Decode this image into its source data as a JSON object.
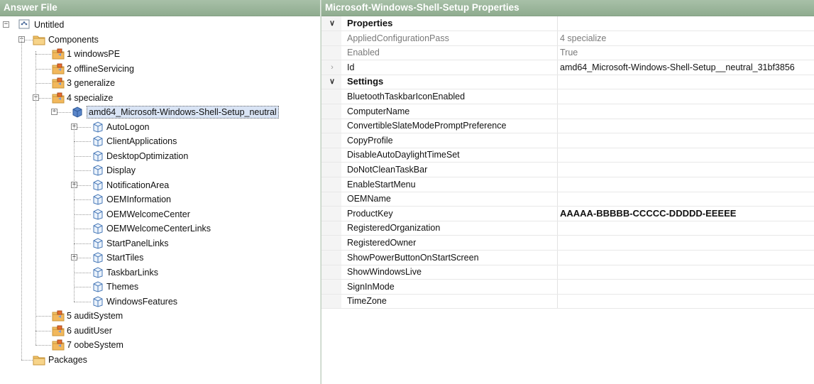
{
  "left_pane": {
    "title": "Answer File",
    "tree": {
      "root": "Untitled",
      "components": "Components",
      "passes": [
        "1 windowsPE",
        "2 offlineServicing",
        "3 generalize",
        "4 specialize"
      ],
      "component": "amd64_Microsoft-Windows-Shell-Setup_neutral",
      "settings": [
        "AutoLogon",
        "ClientApplications",
        "DesktopOptimization",
        "Display",
        "NotificationArea",
        "OEMInformation",
        "OEMWelcomeCenter",
        "OEMWelcomeCenterLinks",
        "StartPanelLinks",
        "StartTiles",
        "TaskbarLinks",
        "Themes",
        "WindowsFeatures"
      ],
      "later_passes": [
        "5 auditSystem",
        "6 auditUser",
        "7 oobeSystem"
      ],
      "packages": "Packages"
    }
  },
  "right_pane": {
    "title": "Microsoft-Windows-Shell-Setup Properties",
    "properties_category": "Properties",
    "properties": [
      {
        "name": "AppliedConfigurationPass",
        "value": "4 specialize"
      },
      {
        "name": "Enabled",
        "value": "True"
      },
      {
        "name": "Id",
        "value": "amd64_Microsoft-Windows-Shell-Setup__neutral_31bf3856"
      }
    ],
    "settings_category": "Settings",
    "settings": [
      {
        "name": "BluetoothTaskbarIconEnabled",
        "value": ""
      },
      {
        "name": "ComputerName",
        "value": ""
      },
      {
        "name": "ConvertibleSlateModePromptPreference",
        "value": ""
      },
      {
        "name": "CopyProfile",
        "value": ""
      },
      {
        "name": "DisableAutoDaylightTimeSet",
        "value": ""
      },
      {
        "name": "DoNotCleanTaskBar",
        "value": ""
      },
      {
        "name": "EnableStartMenu",
        "value": ""
      },
      {
        "name": "OEMName",
        "value": ""
      },
      {
        "name": "ProductKey",
        "value": "AAAAA-BBBBB-CCCCC-DDDDD-EEEEE"
      },
      {
        "name": "RegisteredOrganization",
        "value": ""
      },
      {
        "name": "RegisteredOwner",
        "value": ""
      },
      {
        "name": "ShowPowerButtonOnStartScreen",
        "value": ""
      },
      {
        "name": "ShowWindowsLive",
        "value": ""
      },
      {
        "name": "SignInMode",
        "value": ""
      },
      {
        "name": "TimeZone",
        "value": ""
      }
    ]
  },
  "colors": {
    "header_bg": "#98b498",
    "header_text": "#ffffff",
    "selection_bg": "#d9e4f5",
    "folder_icon": "#f2c46a",
    "component_icon": "#5b86c9"
  },
  "icons": {
    "root": "answer-file-icon",
    "folder": "folder-icon",
    "pass": "configuration-pass-icon",
    "component": "component-cube-icon",
    "setting": "setting-cube-icon"
  }
}
